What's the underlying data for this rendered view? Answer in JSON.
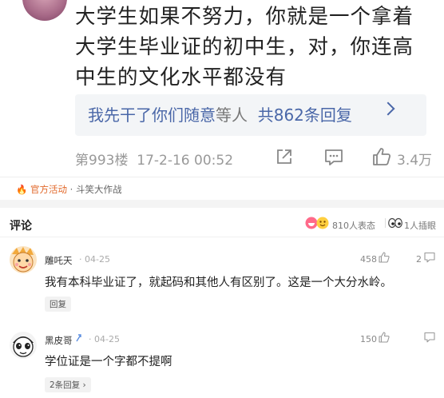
{
  "post": {
    "text": "大学生如果不努力，你就是一个拿着大学生毕业证的初中生，对，你连高中生的文化水平都没有",
    "reply_prefix": "我先干了你们随意",
    "reply_mid": "等人",
    "reply_count": "共862条回复",
    "floor": "第993楼",
    "datetime": "17-2-16 00:52",
    "likes": "3.4万"
  },
  "activity": {
    "icon": "fire-icon",
    "tag": "官方活动",
    "name": "· 斗笑大作战"
  },
  "comments_header": {
    "title": "评论",
    "reactions": "810人表态",
    "inserts": "1人插眼"
  },
  "comments": [
    {
      "name": "雕吒天",
      "date": "· 04-25",
      "text": "我有本科毕业证了，就起码和其他人有区别了。这是一个大分水岭。",
      "likes": "458",
      "replies": "2",
      "action": "回复"
    },
    {
      "name": "黑皮哥",
      "date": "· 04-25",
      "text": "学位证是一个字都不提啊",
      "likes": "150",
      "replies": "",
      "action": "2条回复"
    }
  ],
  "colors": {
    "link": "#4a67a8",
    "accent": "#ff5a1f",
    "muted": "#999999"
  }
}
